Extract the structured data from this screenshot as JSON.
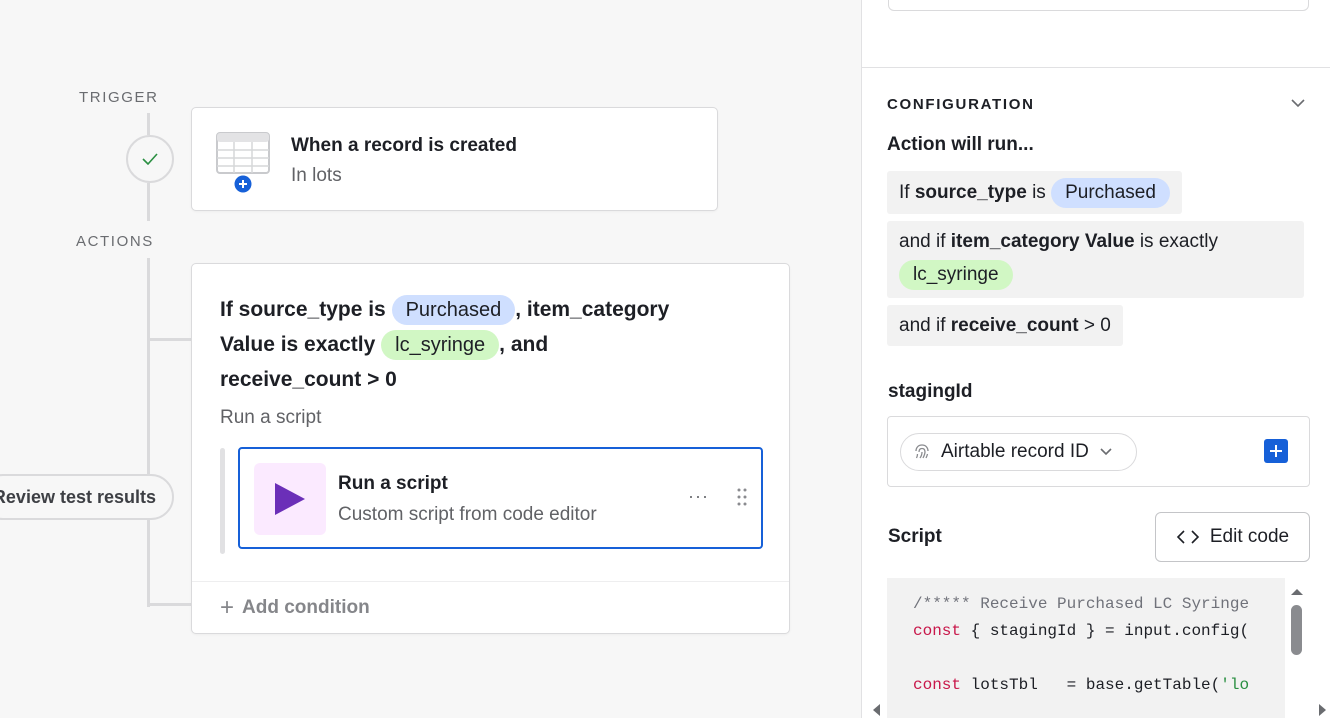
{
  "flow": {
    "trigger_label": "TRIGGER",
    "actions_label": "ACTIONS",
    "trigger_card": {
      "title": "When a record is created",
      "subtitle": "In lots",
      "icon": "table-add-icon"
    },
    "condition": {
      "if_prefix": "If source_type is",
      "pill1": "Purchased",
      "middle": ", item_category Value is exactly",
      "pill2": "lc_syringe",
      "suffix": ", and",
      "last": "receive_count > 0"
    },
    "run_label": "Run a script",
    "script_card": {
      "title": "Run a script",
      "subtitle": "Custom script from code editor",
      "more": "···",
      "icon": "play-icon"
    },
    "add_condition": "Add condition",
    "review_button": "Review test results"
  },
  "panel": {
    "config_header": "CONFIGURATION",
    "action_will_run": "Action will run...",
    "rows": [
      {
        "prefix": "If",
        "field": "source_type",
        "op": "is",
        "pill": "Purchased"
      },
      {
        "prefix": "and if",
        "field": "item_category Value",
        "op": "is exactly",
        "pill": "lc_syringe"
      },
      {
        "prefix": "and if",
        "field": "receive_count",
        "op": "> 0"
      }
    ],
    "staging_label": "stagingId",
    "record_pill": "Airtable record ID",
    "script_label": "Script",
    "edit_code": "Edit code",
    "code": {
      "line1": "/***** Receive Purchased LC Syringe",
      "line2_kw": "const",
      "line2_rest": " { stagingId } = input.config(",
      "line4_kw": "const",
      "line4_rest": " lotsTbl   = base.getTable(",
      "line4_str": "'lo"
    }
  },
  "colors": {
    "accent_blue": "#1660d8",
    "pill_blue": "#cfdfff",
    "pill_green": "#d1f7c4",
    "script_purple": "#6b2fb8",
    "script_bg": "#fbeaff",
    "check_green": "#2a8f42"
  }
}
